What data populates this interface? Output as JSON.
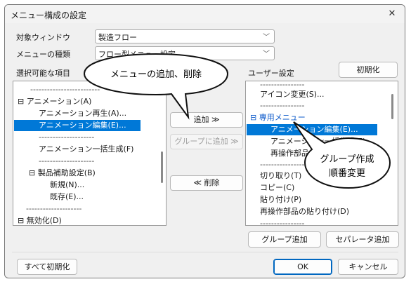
{
  "window": {
    "title": "メニュー構成の設定",
    "close_glyph": "✕"
  },
  "target_window": {
    "label": "対象ウィンドウ",
    "value": "製造フロー"
  },
  "menu_type": {
    "label": "メニューの種類",
    "value": "フロー型メニュー設定"
  },
  "available_items": {
    "label": "選択可能な項目",
    "items": [
      "-------------------------",
      "⊟ アニメーション(A)",
      "アニメーション再生(A)...",
      "アニメーション編集(E)...",
      "--------------------",
      "アニメーション一括生成(F)",
      "--------------------",
      "⊟ 製品補助設定(B)",
      "新規(N)...",
      "既存(E)...",
      "--------------------",
      "⊟ 無効化(D)"
    ]
  },
  "buttons": {
    "add": "追加 ≫",
    "add_to_group": "グループに追加 ≫",
    "delete": "≪ 削除",
    "reset": "初期化",
    "group_add": "グループ追加",
    "separator_add": "セパレータ追加",
    "reset_all": "すべて初期化",
    "ok": "OK",
    "cancel": "キャンセル"
  },
  "user_settings": {
    "label": "ユーザー設定",
    "items": [
      "----------------",
      "アイコン変更(S)...",
      "----------------",
      "⊟ 専用メニュー",
      "アニメーション編集(E)...",
      "アニメーション一括生成(F)",
      "再操作部品...",
      "----------------",
      "切り取り(T)",
      "コピー(C)",
      "貼り付け(P)",
      "再操作部品の貼り付け(D)",
      "----------------"
    ]
  },
  "callouts": {
    "menu_add_delete": "メニューの追加、削除",
    "group_line1": "グループ作成",
    "group_line2": "順番変更"
  },
  "colors": {
    "selection": "#0078d7",
    "group_header": "#0a58ca",
    "accent_border": "#0067c0"
  }
}
